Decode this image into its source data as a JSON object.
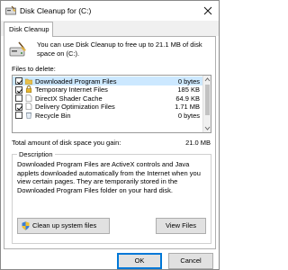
{
  "window": {
    "title": "Disk Cleanup for  (C:)",
    "close_label": "×"
  },
  "tabs": [
    {
      "label": "Disk Cleanup"
    }
  ],
  "intro_text": "You can use Disk Cleanup to free up to 21.1 MB of disk space on  (C:).",
  "files_label": "Files to delete:",
  "files": [
    {
      "checked": true,
      "icon": "folder-icon",
      "name": "Downloaded Program Files",
      "size": "0 bytes",
      "selected": true
    },
    {
      "checked": true,
      "icon": "lock-icon",
      "name": "Temporary Internet Files",
      "size": "185 KB",
      "selected": false
    },
    {
      "checked": false,
      "icon": "file-icon",
      "name": "DirectX Shader Cache",
      "size": "64.9 KB",
      "selected": false
    },
    {
      "checked": true,
      "icon": "file-icon",
      "name": "Delivery Optimization Files",
      "size": "1.71 MB",
      "selected": false
    },
    {
      "checked": false,
      "icon": "recycle-bin-icon",
      "name": "Recycle Bin",
      "size": "0 bytes",
      "selected": false
    }
  ],
  "total": {
    "label": "Total amount of disk space you gain:",
    "value": "21.0 MB"
  },
  "description": {
    "title": "Description",
    "text": "Downloaded Program Files are ActiveX controls and Java applets downloaded automatically from the Internet when you view certain pages. They are temporarily stored in the Downloaded Program Files folder on your hard disk."
  },
  "buttons": {
    "cleanup_system": "Clean up system files",
    "view_files": "View Files",
    "ok": "OK",
    "cancel": "Cancel"
  },
  "colors": {
    "accent": "#0078d7",
    "selection": "#cce8ff"
  }
}
